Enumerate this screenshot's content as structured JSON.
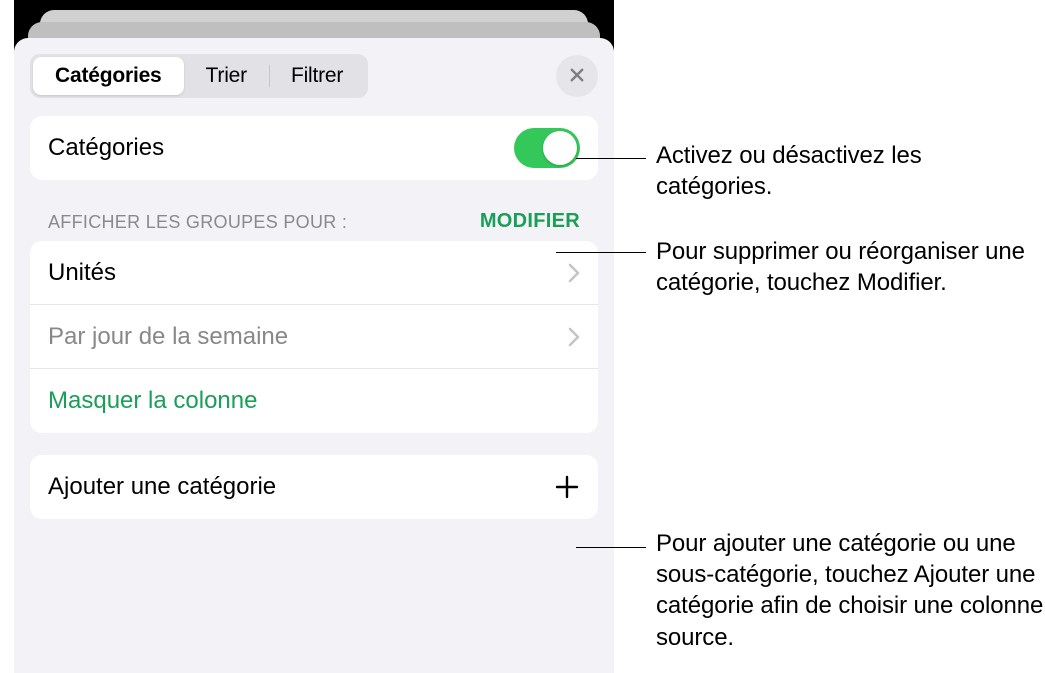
{
  "tabs": {
    "categories": "Catégories",
    "sort": "Trier",
    "filter": "Filtrer"
  },
  "main": {
    "categories_label": "Catégories",
    "toggle_on": true
  },
  "section": {
    "header": "AFFICHER LES GROUPES POUR :",
    "edit": "MODIFIER",
    "rows": {
      "units": "Unités",
      "weekday_prefix": "Par ",
      "weekday_rest": "jour de la semaine",
      "hide_column": "Masquer la colonne"
    }
  },
  "add": {
    "label": "Ajouter une catégorie"
  },
  "callouts": {
    "toggle": "Activez ou désactivez les catégories.",
    "modify": "Pour supprimer ou réorganiser une catégorie, touchez Modifier.",
    "add": "Pour ajouter une catégorie ou une sous-catégorie, touchez Ajouter une catégorie afin de choisir une colonne source."
  },
  "icons": {
    "close": "close-icon",
    "chevron": "chevron-right-icon",
    "plus": "plus-icon"
  }
}
